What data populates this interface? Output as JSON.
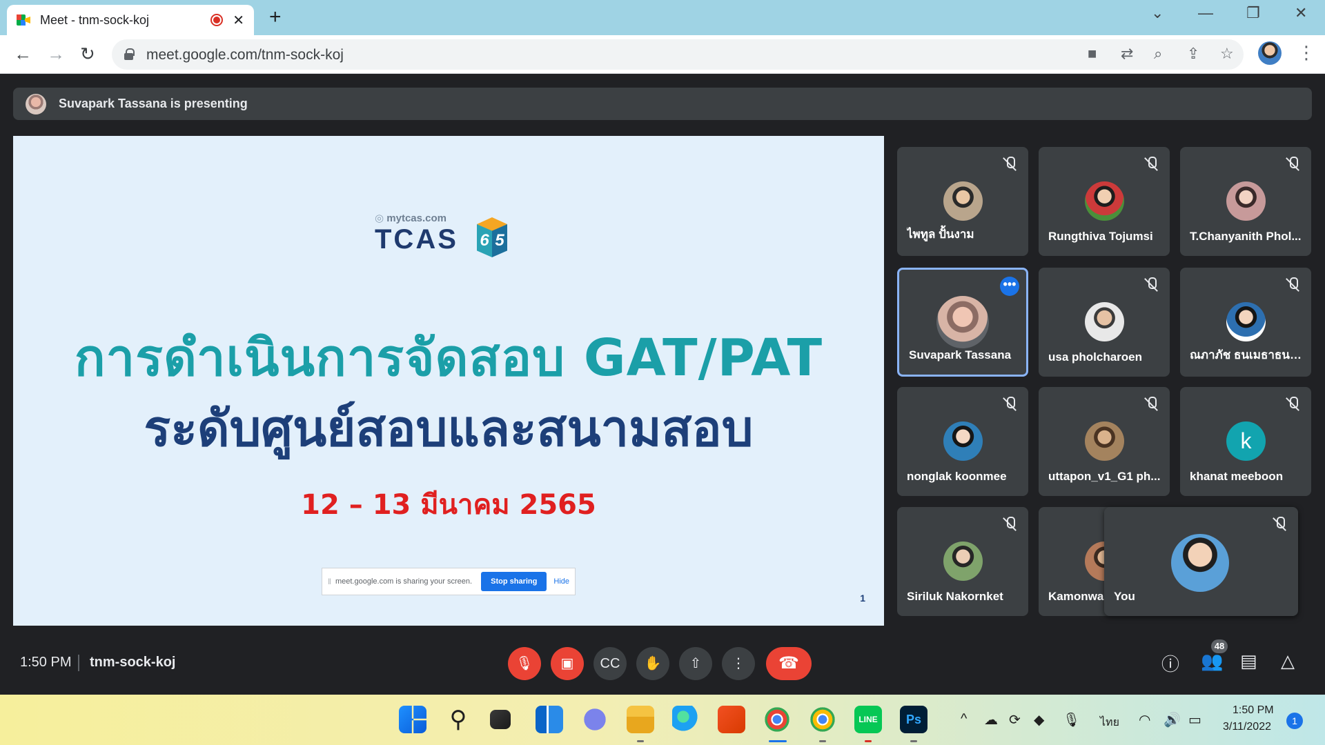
{
  "browser": {
    "tab_title": "Meet - tnm-sock-koj",
    "tab_close": "✕",
    "new_tab": "+",
    "url": "meet.google.com/tnm-sock-koj",
    "window_controls": [
      "⌄",
      "—",
      "❐",
      "✕"
    ]
  },
  "meet": {
    "presenting_text": "Suvapark Tassana is presenting",
    "slide": {
      "logo_site": "mytcas.com",
      "logo_word": "TCAS",
      "logo_num_left": "6",
      "logo_num_right": "5",
      "title_line1": "การดำเนินการจัดสอบ GAT/PAT",
      "title_line2": "ระดับศูนย์สอบและสนามสอบ",
      "date": "12 – 13 มีนาคม 2565",
      "page_number": "1",
      "share_banner": {
        "text": "meet.google.com is sharing your screen.",
        "stop_label": "Stop sharing",
        "hide_label": "Hide"
      }
    },
    "participants": [
      {
        "name": "ไพทูล ปั้นงาม",
        "avatar_color": "#b9a58c"
      },
      {
        "name": "Rungthiva Tojumsi",
        "avatar_color": "#cc3a3a"
      },
      {
        "name": "T.Chanyanith Phol...",
        "avatar_color": "#c79a9a"
      },
      {
        "name": "Suvapark Tassana",
        "avatar_color": "#d8b4a6"
      },
      {
        "name": "usa pholcharoen",
        "avatar_color": "#c8c8c8"
      },
      {
        "name": "ณภาภัช ธนเมธาธนาธิป",
        "avatar_color": "#2d6fb0"
      },
      {
        "name": "nonglak koonmee",
        "avatar_color": "#2f7fb8"
      },
      {
        "name": "uttapon_v1_G1 ph...",
        "avatar_color": "#a4835e"
      },
      {
        "name": "khanat meeboon",
        "avatar_letter": "k",
        "avatar_color": "#12a4af"
      },
      {
        "name": "Siriluk Nakornket",
        "avatar_color": "#7fa36b"
      },
      {
        "name": "Kamonwa",
        "avatar_color": "#b57a5a"
      }
    ],
    "self_tile": {
      "name": "You"
    },
    "bottom_bar": {
      "time": "1:50 PM",
      "meeting_code": "tnm-sock-koj",
      "people_count": "48"
    }
  },
  "taskbar": {
    "language": "ไทย",
    "clock_time": "1:50 PM",
    "clock_date": "3/11/2022",
    "notification_count": "1"
  },
  "colors": {
    "meet_bg": "#202124",
    "tile_bg": "#3c4043",
    "danger": "#ea4335",
    "accent": "#1a73e8",
    "slide_title_teal": "#1b9fa8",
    "slide_title_navy": "#1d3f79",
    "slide_date_red": "#e02020"
  }
}
